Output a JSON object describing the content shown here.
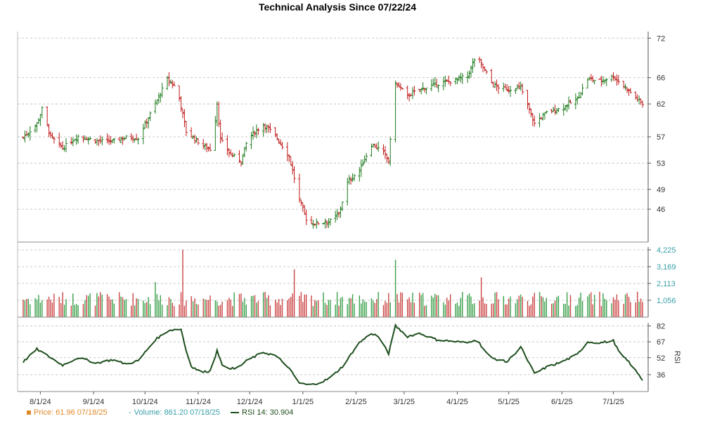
{
  "title": "Technical Analysis Since 07/22/24",
  "colors": {
    "up": "#1a7a1a",
    "down": "#c01818",
    "rsi": "#1f4f1f",
    "price_legend": "#e08a2a",
    "volume_legend": "#3aa0a8",
    "rsi_legend": "#1f4f1f"
  },
  "legend": {
    "price": "Price: 61.96  07/18/25",
    "volume": "Volume: 861.20  07/18/25",
    "rsi": "RSI 14: 30.904"
  },
  "chart_data": [
    {
      "type": "candlestick",
      "panel": "price",
      "title": "Technical Analysis Since 07/22/24",
      "ylim": [
        41,
        73
      ],
      "yticks": [
        "72",
        "66",
        "62",
        "57",
        "53",
        "49",
        "46"
      ],
      "xticks": [
        "8/1/24",
        "9/1/24",
        "10/1/24",
        "11/1/24",
        "12/1/24",
        "1/1/25",
        "2/1/25",
        "3/1/25",
        "4/1/25",
        "5/1/25",
        "6/1/25",
        "7/1/25"
      ],
      "x_range": [
        "2024-07-22",
        "2025-07-18"
      ],
      "close_anchors": [
        [
          "2024-07-22",
          56.9
        ],
        [
          "2024-07-30",
          59.0
        ],
        [
          "2024-08-02",
          61.2
        ],
        [
          "2024-08-07",
          57.0
        ],
        [
          "2024-08-14",
          55.3
        ],
        [
          "2024-08-23",
          57.1
        ],
        [
          "2024-09-03",
          56.4
        ],
        [
          "2024-09-12",
          56.3
        ],
        [
          "2024-09-20",
          56.9
        ],
        [
          "2024-09-27",
          56.8
        ],
        [
          "2024-10-07",
          62.0
        ],
        [
          "2024-10-14",
          65.8
        ],
        [
          "2024-10-20",
          64.2
        ],
        [
          "2024-10-25",
          57.8
        ],
        [
          "2024-11-04",
          55.6
        ],
        [
          "2024-11-09",
          55.0
        ],
        [
          "2024-11-12",
          62.1
        ],
        [
          "2024-11-14",
          56.5
        ],
        [
          "2024-11-20",
          54.3
        ],
        [
          "2024-11-26",
          53.4
        ],
        [
          "2024-11-30",
          56.8
        ],
        [
          "2024-12-09",
          58.9
        ],
        [
          "2024-12-16",
          57.2
        ],
        [
          "2024-12-24",
          54.0
        ],
        [
          "2024-12-30",
          47.5
        ],
        [
          "2025-01-04",
          43.8
        ],
        [
          "2025-01-10",
          43.9
        ],
        [
          "2025-01-17",
          44.2
        ],
        [
          "2025-01-22",
          45.3
        ],
        [
          "2025-01-27",
          50.0
        ],
        [
          "2025-02-03",
          52.0
        ],
        [
          "2025-02-10",
          55.8
        ],
        [
          "2025-02-16",
          55.0
        ],
        [
          "2025-02-20",
          53.4
        ],
        [
          "2025-02-24",
          65.2
        ],
        [
          "2025-03-03",
          63.2
        ],
        [
          "2025-03-10",
          64.2
        ],
        [
          "2025-03-20",
          65.0
        ],
        [
          "2025-03-27",
          65.4
        ],
        [
          "2025-04-07",
          66.2
        ],
        [
          "2025-04-12",
          69.4
        ],
        [
          "2025-04-22",
          64.8
        ],
        [
          "2025-04-30",
          64.2
        ],
        [
          "2025-05-08",
          64.5
        ],
        [
          "2025-05-16",
          59.0
        ],
        [
          "2025-05-23",
          60.7
        ],
        [
          "2025-06-01",
          61.4
        ],
        [
          "2025-06-10",
          62.8
        ],
        [
          "2025-06-16",
          65.8
        ],
        [
          "2025-06-23",
          65.5
        ],
        [
          "2025-07-01",
          66.2
        ],
        [
          "2025-07-05",
          65.2
        ],
        [
          "2025-07-10",
          64.0
        ],
        [
          "2025-07-18",
          61.96
        ]
      ]
    },
    {
      "type": "bar",
      "panel": "volume",
      "ylim": [
        0,
        4225
      ],
      "yticks": [
        "4,225",
        "3,169",
        "2,113",
        "1,056"
      ],
      "spikes": [
        [
          "2024-10-23",
          4225
        ],
        [
          "2025-02-24",
          3600
        ],
        [
          "2024-12-27",
          3000
        ],
        [
          "2024-11-09",
          2800
        ],
        [
          "2024-10-07",
          2200
        ],
        [
          "2025-04-15",
          2500
        ]
      ]
    },
    {
      "type": "line",
      "panel": "rsi",
      "name": "RSI 14",
      "ylim": [
        20,
        85
      ],
      "yticks": [
        "82",
        "67",
        "52",
        "36"
      ],
      "anchors": [
        [
          "2024-07-22",
          48
        ],
        [
          "2024-07-30",
          60
        ],
        [
          "2024-08-05",
          54
        ],
        [
          "2024-08-14",
          45
        ],
        [
          "2024-08-23",
          52
        ],
        [
          "2024-09-03",
          47
        ],
        [
          "2024-09-12",
          50
        ],
        [
          "2024-09-20",
          46
        ],
        [
          "2024-09-27",
          49
        ],
        [
          "2024-10-07",
          69
        ],
        [
          "2024-10-15",
          78
        ],
        [
          "2024-10-22",
          79
        ],
        [
          "2024-10-27",
          45
        ],
        [
          "2024-11-03",
          38
        ],
        [
          "2024-11-09",
          40
        ],
        [
          "2024-11-12",
          60
        ],
        [
          "2024-11-15",
          44
        ],
        [
          "2024-11-23",
          41
        ],
        [
          "2024-11-30",
          50
        ],
        [
          "2024-12-09",
          57
        ],
        [
          "2024-12-16",
          54
        ],
        [
          "2024-12-23",
          44
        ],
        [
          "2024-12-30",
          28
        ],
        [
          "2025-01-05",
          26
        ],
        [
          "2025-01-12",
          29
        ],
        [
          "2025-01-17",
          33
        ],
        [
          "2025-01-25",
          45
        ],
        [
          "2025-02-02",
          65
        ],
        [
          "2025-02-10",
          75
        ],
        [
          "2025-02-14",
          72
        ],
        [
          "2025-02-20",
          56
        ],
        [
          "2025-02-24",
          82
        ],
        [
          "2025-03-03",
          72
        ],
        [
          "2025-03-10",
          75
        ],
        [
          "2025-03-20",
          69
        ],
        [
          "2025-04-01",
          67
        ],
        [
          "2025-04-07",
          66
        ],
        [
          "2025-04-12",
          70
        ],
        [
          "2025-04-20",
          52
        ],
        [
          "2025-04-30",
          48
        ],
        [
          "2025-05-08",
          62
        ],
        [
          "2025-05-16",
          37
        ],
        [
          "2025-05-23",
          43
        ],
        [
          "2025-06-01",
          48
        ],
        [
          "2025-06-10",
          55
        ],
        [
          "2025-06-16",
          67
        ],
        [
          "2025-06-23",
          66
        ],
        [
          "2025-07-01",
          68
        ],
        [
          "2025-07-05",
          55
        ],
        [
          "2025-07-10",
          48
        ],
        [
          "2025-07-18",
          30.9
        ]
      ]
    }
  ]
}
